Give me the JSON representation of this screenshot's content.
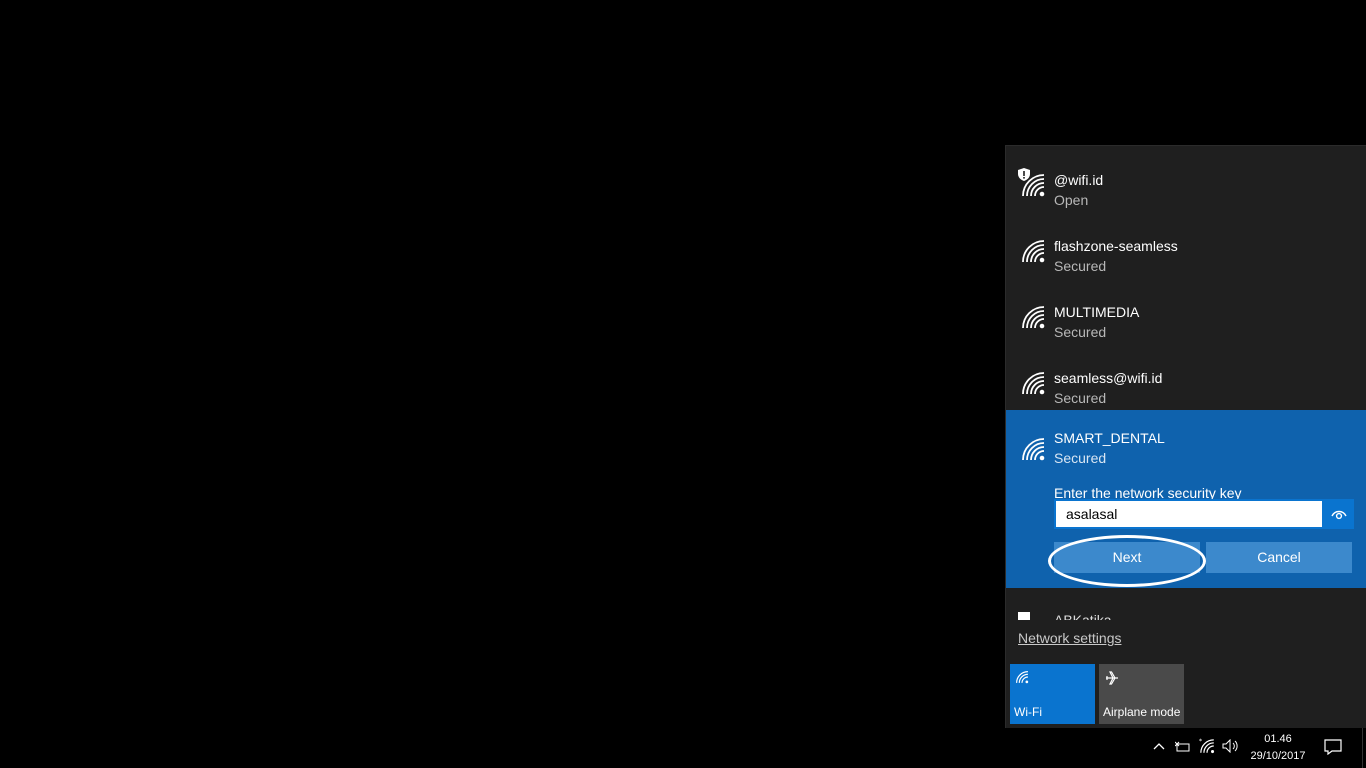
{
  "networks": [
    {
      "name": "@wifi.id",
      "status": "Open",
      "icon": "wifi-shield-icon"
    },
    {
      "name": "flashzone-seamless",
      "status": "Secured",
      "icon": "wifi-icon"
    },
    {
      "name": "MULTIMEDIA",
      "status": "Secured",
      "icon": "wifi-icon"
    },
    {
      "name": "seamless@wifi.id",
      "status": "Secured",
      "icon": "wifi-icon"
    },
    {
      "name": "SMART_DENTAL",
      "status": "Secured",
      "icon": "wifi-icon"
    }
  ],
  "connect_form": {
    "key_label": "Enter the network security key",
    "key_value": "asalasal",
    "next_label": "Next",
    "cancel_label": "Cancel"
  },
  "partial_network": {
    "name": "ABKatika"
  },
  "footer": {
    "network_settings": "Network settings",
    "tiles": [
      {
        "label": "Wi-Fi",
        "active": true,
        "icon": "wifi-icon"
      },
      {
        "label": "Airplane mode",
        "active": false,
        "icon": "airplane-icon"
      }
    ]
  },
  "taskbar": {
    "time": "01.46",
    "date": "29/10/2017"
  },
  "colors": {
    "accent": "#0a74cf",
    "selected_bg": "#0f62ad",
    "flyout_bg": "#1f1f1f"
  }
}
